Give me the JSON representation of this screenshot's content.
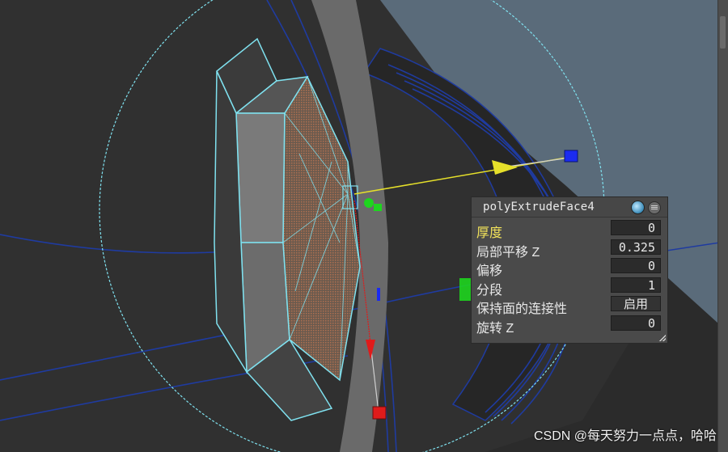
{
  "viewport": {
    "background_color": "#2b2b2b",
    "sky_color": "#5a6b7a",
    "wire_color": "#7fe1ef",
    "edge_color": "#1f3ba0",
    "manipulator": {
      "x_axis_color": "#e01b1b",
      "y_axis_color": "#1ed51e",
      "z_axis_color": "#1b2bf0",
      "arrow_color": "#e6e02a"
    }
  },
  "ive": {
    "title": "polyExtrudeFace4",
    "rows": [
      {
        "label": "厚度",
        "value": "0",
        "highlight": true
      },
      {
        "label": "局部平移 Z",
        "value": "0.325"
      },
      {
        "label": "偏移",
        "value": "0"
      },
      {
        "label": "分段",
        "value": "1"
      },
      {
        "label": "保持面的连接性",
        "value": "启用"
      },
      {
        "label": "旋转 Z",
        "value": "0"
      }
    ]
  },
  "watermark": "CSDN @每天努力一点点，哈哈"
}
